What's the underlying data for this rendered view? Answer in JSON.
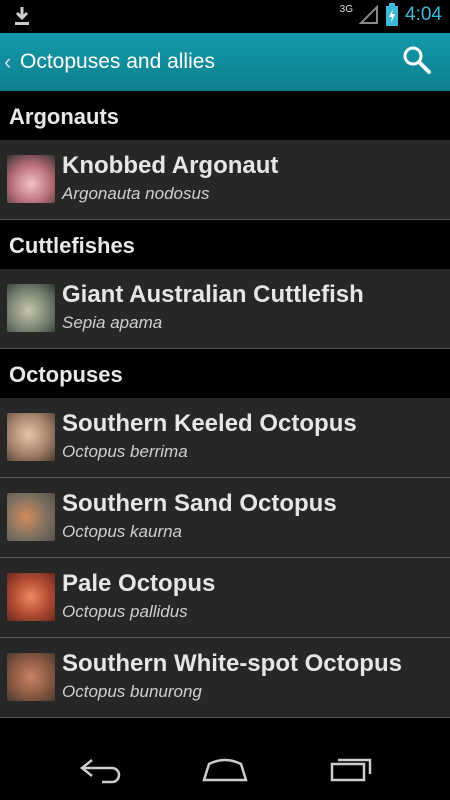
{
  "status_bar": {
    "network": "3G",
    "time": "4:04",
    "icons": [
      "download-icon",
      "signal-icon",
      "battery-charging-icon"
    ],
    "time_color": "#3db9d9"
  },
  "action_bar": {
    "title": "Octopuses and allies",
    "color": "#139aaa",
    "icons": [
      "back-chevron-icon",
      "search-icon"
    ]
  },
  "sections": [
    {
      "title": "Argonauts",
      "items": [
        {
          "name": "Knobbed Argonaut",
          "scientific": "Argonauta nodosus"
        }
      ]
    },
    {
      "title": "Cuttlefishes",
      "items": [
        {
          "name": "Giant Australian Cuttlefish",
          "scientific": "Sepia apama"
        }
      ]
    },
    {
      "title": "Octopuses",
      "items": [
        {
          "name": "Southern Keeled Octopus",
          "scientific": "Octopus berrima"
        },
        {
          "name": "Southern Sand Octopus",
          "scientific": "Octopus kaurna"
        },
        {
          "name": "Pale Octopus",
          "scientific": "Octopus pallidus"
        },
        {
          "name": "Southern White-spot Octopus",
          "scientific": "Octopus bunurong"
        }
      ]
    }
  ],
  "nav_bar": {
    "icons": [
      "back-icon",
      "home-icon",
      "recent-apps-icon"
    ]
  }
}
